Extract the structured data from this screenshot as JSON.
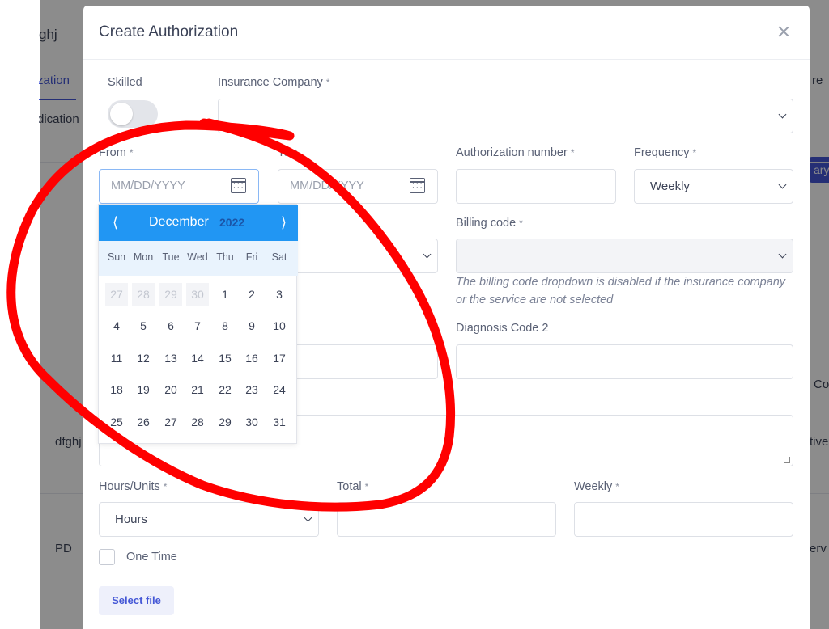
{
  "background": {
    "title_fragment": "ghj",
    "tab_auth_fragment": "zation",
    "tab_medication_fragment": "dication",
    "row1_fragment": "dfghj",
    "row2_fragment": "PD",
    "right_fragment_1": "re",
    "right_button_fragment": "ary",
    "right_fragment_2": "Co",
    "right_fragment_3": "tive",
    "right_fragment_4": "erv"
  },
  "modal": {
    "title": "Create Authorization",
    "skilled_label": "Skilled",
    "insurance_label": "Insurance Company",
    "required_mark": "*",
    "from_label": "From",
    "from_placeholder": "MM/DD/YYYY",
    "to_label": "To",
    "to_placeholder": "MM/DD/YYYY",
    "auth_number_label": "Authorization number",
    "frequency_label": "Frequency",
    "frequency_value": "Weekly",
    "billing_code_label": "Billing code",
    "billing_hint": "The billing code dropdown is disabled if the insurance company or the service are not selected",
    "diagnosis2_label": "Diagnosis Code 2",
    "hours_units_label": "Hours/Units",
    "hours_units_value": "Hours",
    "total_label": "Total",
    "weekly_label": "Weekly",
    "one_time_label": "One Time",
    "select_file_label": "Select file"
  },
  "datepicker": {
    "prev": "⟨",
    "next": "⟩",
    "month": "December",
    "year": "2022",
    "weekdays": [
      "Sun",
      "Mon",
      "Tue",
      "Wed",
      "Thu",
      "Fri",
      "Sat"
    ],
    "weeks": [
      [
        "27",
        "28",
        "29",
        "30",
        "1",
        "2",
        "3"
      ],
      [
        "4",
        "5",
        "6",
        "7",
        "8",
        "9",
        "10"
      ],
      [
        "11",
        "12",
        "13",
        "14",
        "15",
        "16",
        "17"
      ],
      [
        "18",
        "19",
        "20",
        "21",
        "22",
        "23",
        "24"
      ],
      [
        "25",
        "26",
        "27",
        "28",
        "29",
        "30",
        "31"
      ]
    ],
    "other_month_days_in_first_week": 4
  },
  "colors": {
    "accent": "#2196f3",
    "primary_button": "#4457d6",
    "annotation": "#ff0000"
  }
}
